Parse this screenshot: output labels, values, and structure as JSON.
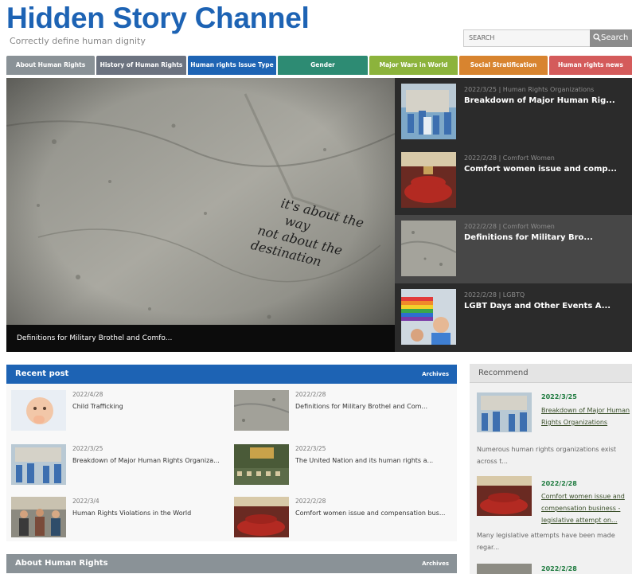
{
  "site": {
    "title": "Hidden Story Channel",
    "tagline": "Correctly define human dignity"
  },
  "search": {
    "placeholder": "SEARCH",
    "button_label": "Search"
  },
  "nav": {
    "items": [
      {
        "label": "About Human Rights",
        "color": "#8a9297"
      },
      {
        "label": "History of Human Rights",
        "color": "#6c7380"
      },
      {
        "label": "Human rights Issue Type",
        "color": "#1e64b4"
      },
      {
        "label": "Gender",
        "color": "#2d8b73"
      },
      {
        "label": "Major Wars in World",
        "color": "#8cb33c"
      },
      {
        "label": "Social Stratification",
        "color": "#d8842f"
      },
      {
        "label": "Human rights news",
        "color": "#d45b5b"
      }
    ]
  },
  "hero": {
    "handwriting": [
      "it's about the",
      "way",
      "not about the",
      "destination"
    ],
    "caption": "Definitions for Military Brothel and Comfo..."
  },
  "slides": [
    {
      "meta": "2022/3/25 | Human Rights Organizations",
      "title": "Breakdown of Major Human Rig..."
    },
    {
      "meta": "2022/2/28 | Comfort Women",
      "title": "Comfort women issue and comp..."
    },
    {
      "meta": "2022/2/28 | Comfort Women",
      "title": "Definitions for Military Bro..."
    },
    {
      "meta": "2022/2/28 | LGBTQ",
      "title": "LGBT Days and Other Events A..."
    }
  ],
  "recent": {
    "title": "Recent post",
    "archives_label": "Archives",
    "posts": [
      {
        "date": "2022/4/28",
        "title": "Child Trafficking"
      },
      {
        "date": "2022/2/28",
        "title": "Definitions for Military Brothel and Com..."
      },
      {
        "date": "2022/3/25",
        "title": "Breakdown of Major Human Rights Organiza..."
      },
      {
        "date": "2022/3/25",
        "title": "The United Nation and its human rights a..."
      },
      {
        "date": "2022/3/4",
        "title": "Human Rights Violations in the World"
      },
      {
        "date": "2022/2/28",
        "title": "Comfort women issue and compensation bus..."
      }
    ]
  },
  "about_section": {
    "title": "About Human Rights",
    "archives_label": "Archives"
  },
  "recommend": {
    "title": "Recommend",
    "items": [
      {
        "date": "2022/3/25",
        "title": "Breakdown of Major Human Rights Organizations",
        "excerpt": "Numerous human rights organizations exist across t..."
      },
      {
        "date": "2022/2/28",
        "title": "Comfort women issue and compensation business - legislative attempt on...",
        "excerpt": "Many legislative attempts have been made regar..."
      },
      {
        "date": "2022/2/28"
      }
    ]
  },
  "colors": {
    "brand": "#1d63b4",
    "recent_bar": "#1d63b4",
    "about_bar": "#8a9297",
    "recommend_date": "#1d7a3e"
  },
  "icons": {
    "search_button": "magnifier-icon"
  }
}
